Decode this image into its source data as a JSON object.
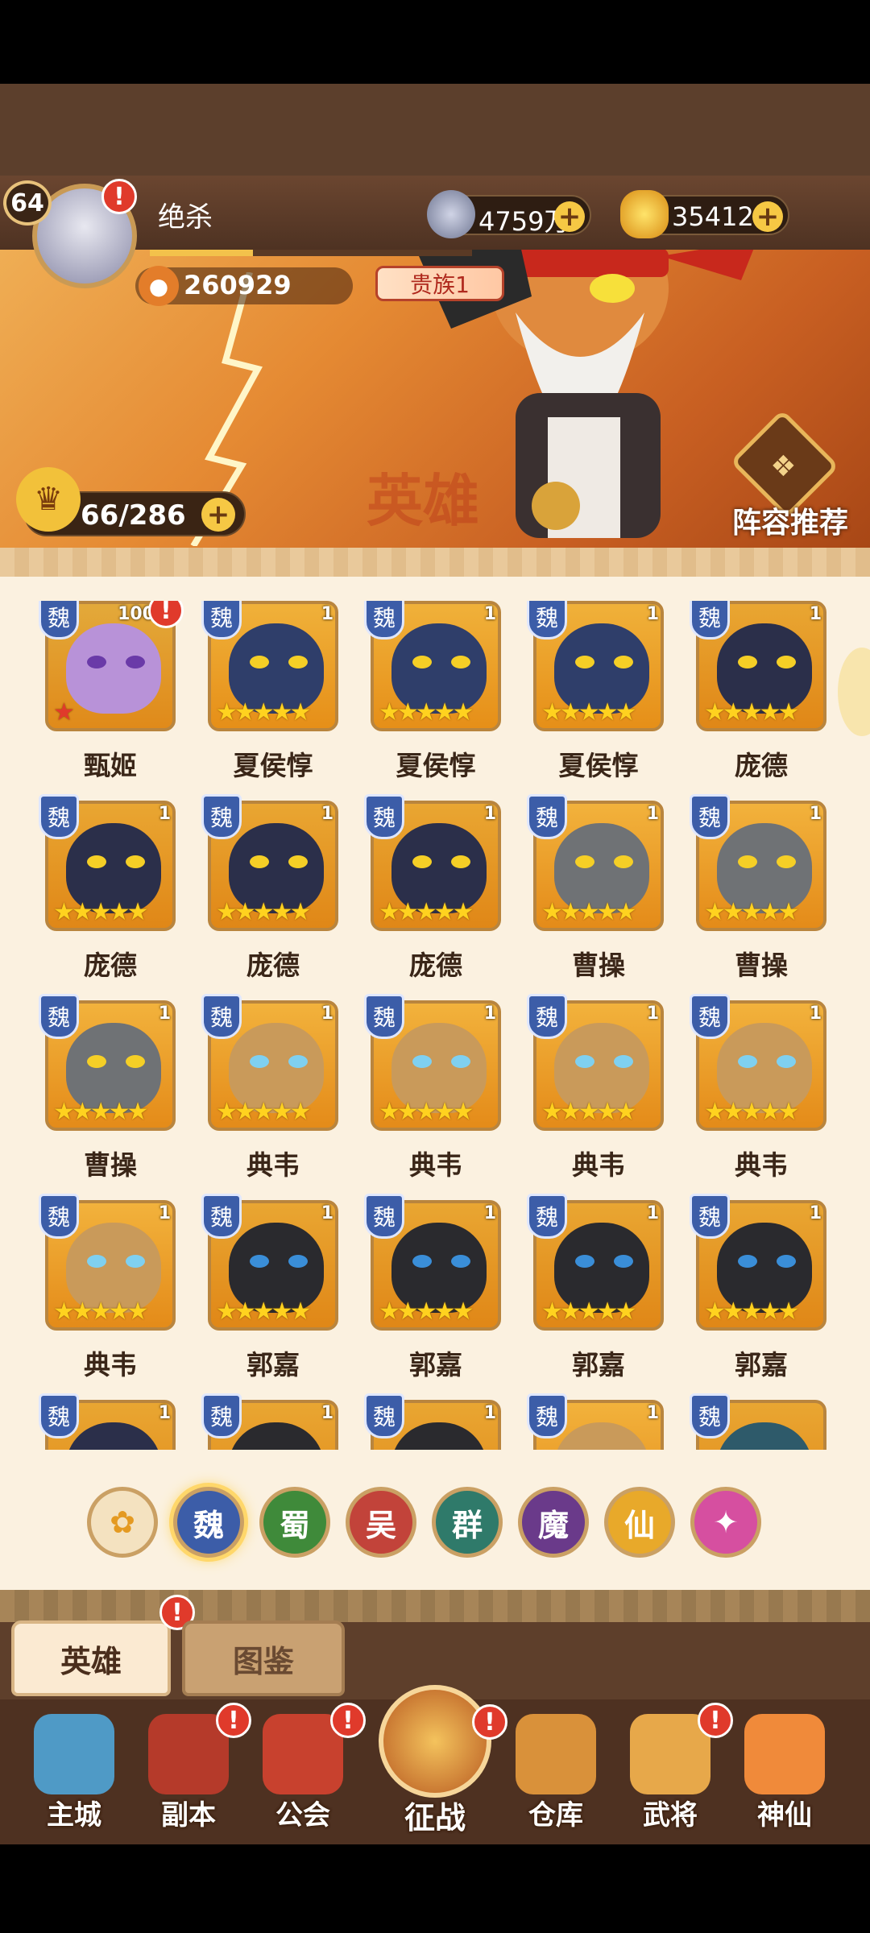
{
  "player": {
    "level": "64",
    "name": "绝杀",
    "power": "260929",
    "noble": "贵族1",
    "xp_fraction": 0.32
  },
  "currencies": {
    "coins": "4759万",
    "gold": "35412"
  },
  "banner": {
    "hero_count": "66/286",
    "recommend_label": "阵容推荐",
    "watermark": "英雄"
  },
  "hero_grid": {
    "faction_label": "魏",
    "cards": [
      {
        "name": "甄姬",
        "level": "100",
        "stars": 1,
        "palette": "purple"
      },
      {
        "name": "夏侯惇",
        "level": "1",
        "stars": 5,
        "palette": "blue"
      },
      {
        "name": "夏侯惇",
        "level": "1",
        "stars": 5,
        "palette": "blue"
      },
      {
        "name": "夏侯惇",
        "level": "1",
        "stars": 5,
        "palette": "blue"
      },
      {
        "name": "庞德",
        "level": "1",
        "stars": 5,
        "palette": "navy"
      },
      {
        "name": "庞德",
        "level": "1",
        "stars": 5,
        "palette": "navy"
      },
      {
        "name": "庞德",
        "level": "1",
        "stars": 5,
        "palette": "navy"
      },
      {
        "name": "庞德",
        "level": "1",
        "stars": 5,
        "palette": "navy"
      },
      {
        "name": "曹操",
        "level": "1",
        "stars": 5,
        "palette": "gray"
      },
      {
        "name": "曹操",
        "level": "1",
        "stars": 5,
        "palette": "gray"
      },
      {
        "name": "曹操",
        "level": "1",
        "stars": 5,
        "palette": "gray"
      },
      {
        "name": "典韦",
        "level": "1",
        "stars": 5,
        "palette": "tan"
      },
      {
        "name": "典韦",
        "level": "1",
        "stars": 5,
        "palette": "tan"
      },
      {
        "name": "典韦",
        "level": "1",
        "stars": 5,
        "palette": "tan"
      },
      {
        "name": "典韦",
        "level": "1",
        "stars": 5,
        "palette": "tan"
      },
      {
        "name": "典韦",
        "level": "1",
        "stars": 5,
        "palette": "tan"
      },
      {
        "name": "郭嘉",
        "level": "1",
        "stars": 5,
        "palette": "white"
      },
      {
        "name": "郭嘉",
        "level": "1",
        "stars": 5,
        "palette": "white"
      },
      {
        "name": "郭嘉",
        "level": "1",
        "stars": 5,
        "palette": "white"
      },
      {
        "name": "郭嘉",
        "level": "1",
        "stars": 5,
        "palette": "white"
      },
      {
        "name": "",
        "level": "1",
        "stars": 0,
        "palette": "navy"
      },
      {
        "name": "",
        "level": "1",
        "stars": 0,
        "palette": "white"
      },
      {
        "name": "",
        "level": "1",
        "stars": 0,
        "palette": "white"
      },
      {
        "name": "",
        "level": "1",
        "stars": 0,
        "palette": "tan"
      },
      {
        "name": "",
        "level": "",
        "stars": 0,
        "palette": "teal"
      }
    ]
  },
  "filters": [
    {
      "label": "",
      "icon": "paw-icon",
      "color": "#f4e2c0",
      "text_color": "#e49a22"
    },
    {
      "label": "魏",
      "color": "#3c5da8",
      "selected": true
    },
    {
      "label": "蜀",
      "color": "#3f8a3a"
    },
    {
      "label": "吴",
      "color": "#c2433a"
    },
    {
      "label": "群",
      "color": "#2f7a6a"
    },
    {
      "label": "魔",
      "color": "#6a3a8a"
    },
    {
      "label": "仙",
      "color": "#e8a92a"
    },
    {
      "label": "",
      "icon": "spirit-icon",
      "color": "#d64fa0"
    }
  ],
  "tabs": {
    "heroes": "英雄",
    "codex": "图鉴"
  },
  "nav": [
    {
      "label": "主城",
      "icon": "castle-icon",
      "color": "#4f9ac6",
      "alert": false
    },
    {
      "label": "副本",
      "icon": "sword-icon",
      "color": "#b53a2a",
      "alert": true
    },
    {
      "label": "公会",
      "icon": "flag-icon",
      "color": "#c8412e",
      "alert": true
    },
    {
      "label": "征战",
      "icon": "campaign-icon",
      "color": "#d07a2a",
      "alert": true
    },
    {
      "label": "仓库",
      "icon": "bag-icon",
      "color": "#d9913a",
      "alert": false
    },
    {
      "label": "武将",
      "icon": "cat-general-icon",
      "color": "#e7a84a",
      "alert": true
    },
    {
      "label": "神仙",
      "icon": "cat-immortal-icon",
      "color": "#f08a3a",
      "alert": false
    }
  ]
}
